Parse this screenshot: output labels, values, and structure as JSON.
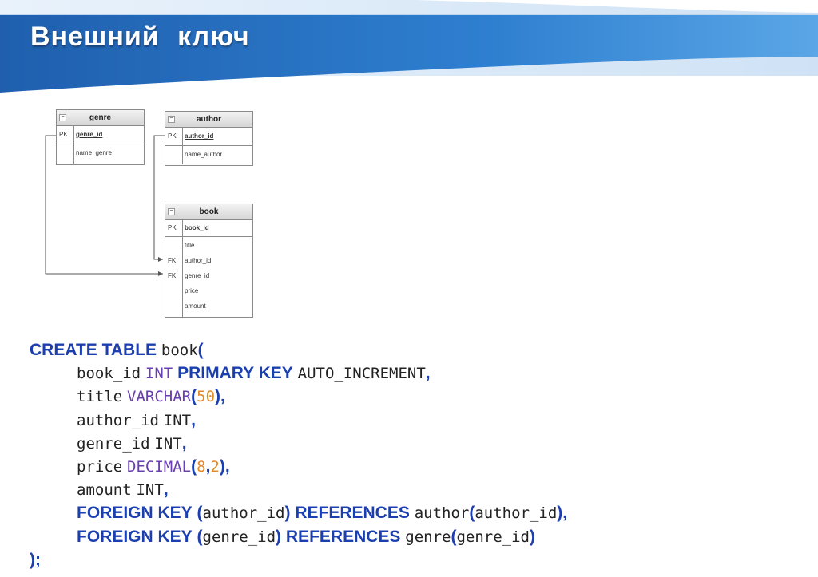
{
  "slide": {
    "title": "Внешний ключ"
  },
  "diagram": {
    "entities": [
      {
        "name": "genre",
        "pk": {
          "key": "PK",
          "field": "genre_id"
        },
        "fields": [
          {
            "key": "",
            "name": "name_genre"
          }
        ]
      },
      {
        "name": "author",
        "pk": {
          "key": "PK",
          "field": "author_id"
        },
        "fields": [
          {
            "key": "",
            "name": "name_author"
          }
        ]
      },
      {
        "name": "book",
        "pk": {
          "key": "PK",
          "field": "book_id"
        },
        "fields": [
          {
            "key": "",
            "name": "title"
          },
          {
            "key": "FK",
            "name": "author_id"
          },
          {
            "key": "FK",
            "name": "genre_id"
          },
          {
            "key": "",
            "name": "price"
          },
          {
            "key": "",
            "name": "amount"
          }
        ]
      }
    ]
  },
  "code": {
    "l1": {
      "kw": "CREATE TABLE",
      "tbl": "book",
      "p": "("
    },
    "l2": {
      "name": "book_id",
      "type": "INT",
      "kw": "PRIMARY KEY",
      "extra": "AUTO_INCREMENT",
      "p": ","
    },
    "l3": {
      "name": "title",
      "type": "VARCHAR",
      "p1": "(",
      "n": "50",
      "p2": "),"
    },
    "l4": {
      "name": "author_id",
      "type": "INT",
      "p": ","
    },
    "l5": {
      "name": "genre_id",
      "type": "INT",
      "p": ","
    },
    "l6": {
      "name": "price",
      "type": "DECIMAL",
      "p1": "(",
      "n1": "8",
      "c": ",",
      "n2": "2",
      "p2": "),"
    },
    "l7": {
      "name": "amount",
      "type": "INT",
      "p": ","
    },
    "l8": {
      "kw1": "FOREIGN KEY",
      "p1": "(",
      "col": "author_id",
      "p2": ")",
      "kw2": "REFERENCES",
      "ref": "author",
      "p3": "(",
      "rcol": "author_id",
      "p4": "),"
    },
    "l9": {
      "kw1": "FOREIGN KEY",
      "p1": "(",
      "col": "genre_id",
      "p2": ")",
      "kw2": "REFERENCES",
      "ref": "genre",
      "p3": "(",
      "rcol": "genre_id",
      "p4": ")"
    },
    "l10": {
      "p": ");"
    }
  }
}
